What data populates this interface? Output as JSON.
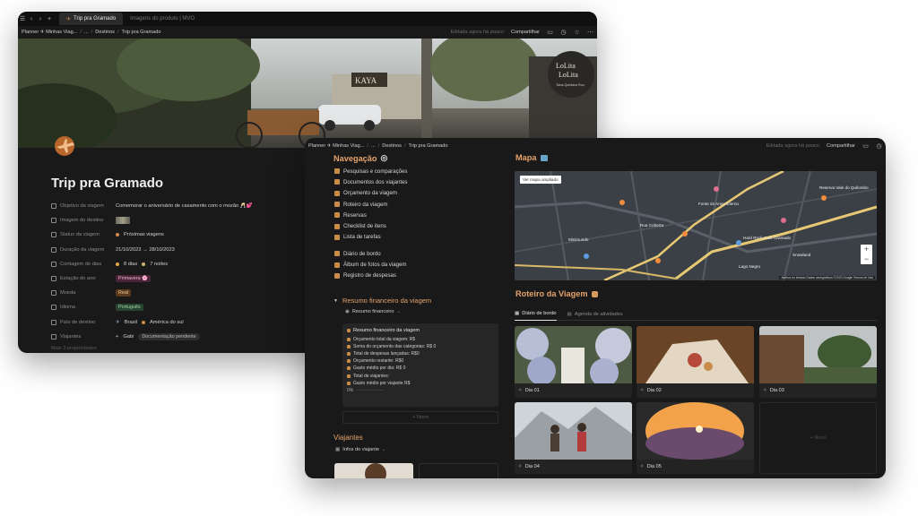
{
  "window1": {
    "tabs": [
      "Trip pra Gramado",
      "Imagens do produto | MVO"
    ],
    "breadcrumb": [
      "Planner ✈ Minhas Viag...",
      "...",
      "Destinos",
      "Trip pra Gramado"
    ],
    "edited": "Editada agora há pouco",
    "share": "Compartilhar",
    "cover_sign": "LoLita",
    "cover_sign_sub": "Talua Quintana Roo",
    "cover_shop": "KAYA",
    "title": "Trip pra Gramado",
    "properties": [
      {
        "name": "Objetivo da viagem",
        "value": "Comemorar o aniversário de casamento com o mozão 🥂💕"
      },
      {
        "name": "Imagem do destino",
        "value": ""
      },
      {
        "name": "Status da viagem",
        "value": "Próximas viagens"
      },
      {
        "name": "Duração da viagem",
        "value": "21/10/2023 → 28/10/2023"
      },
      {
        "name": "Contagem de dias",
        "value": "8 dias",
        "value2": "7 noites"
      },
      {
        "name": "Estação do ano",
        "value": "Primavera 🌸"
      },
      {
        "name": "Moeda",
        "value": "Real"
      },
      {
        "name": "Idioma",
        "value": "Português"
      },
      {
        "name": "País de destino",
        "value": "Brasil",
        "value2": "América do sul"
      },
      {
        "name": "Viajantes",
        "value": "Gabi",
        "value2": "Documentação pendente"
      }
    ],
    "more": "Mais 3 propriedades"
  },
  "window2": {
    "breadcrumb": [
      "Planner ✈ Minhas Viag...",
      "...",
      "Destinos",
      "Trip pra Gramado"
    ],
    "edited": "Editada agora há pouco",
    "share": "Compartilhar",
    "nav_title": "Navegação",
    "nav_items": [
      "Pesquisas e comparações",
      "Documentos dos viajantes",
      "Orçamento da viagem",
      "Roteiro da viagem",
      "Reservas",
      "Checklist de itens",
      "Lista de tarefas"
    ],
    "nav_items2": [
      "Diário de bordo",
      "Álbum de fotos da viagem",
      "Registro de despesas"
    ],
    "resumo_title": "Resumo financeiro da viagem",
    "resumo_tab": "Resumo financeiro",
    "resumo_card_title": "Resumo financeiro da viagem",
    "resumo_lines": [
      "Orçamento total da viagem: R$",
      "Soma do orçamento das categorias: R$ 0",
      "Total de despesas lançadas: R$0",
      "Orçamento restante: R$0",
      "Gasto médio por dia: R$ 0",
      "Total de viajantes:",
      "Gasto médio por viajante R$"
    ],
    "resumo_pct": "0%",
    "novo": "+ Novo",
    "viajantes_title": "Viajantes",
    "viajantes_tab": "Infos do viajante",
    "mapa_title": "Mapa",
    "map_button": "Ver mapa ampliado",
    "map_labels": [
      "Fonte do Amor Eterno",
      "Hard Rock Cafe Gramado",
      "Rua Coberta",
      "Lago Negro",
      "Snowland",
      "Minimundo",
      "Reserva Vale do Quilombo"
    ],
    "map_attr": "Atalhos do teclado  Dados cartográficos ©2023 Google  Termos de Uso",
    "roteiro_title": "Roteiro da Viagem",
    "roteiro_tabs": [
      "Diário de bordo",
      "Agenda de atividades"
    ],
    "days": [
      "Dia 01",
      "Dia 02",
      "Dia 03",
      "Dia 04",
      "Dia 05"
    ],
    "novo_card": "+ Novo"
  }
}
